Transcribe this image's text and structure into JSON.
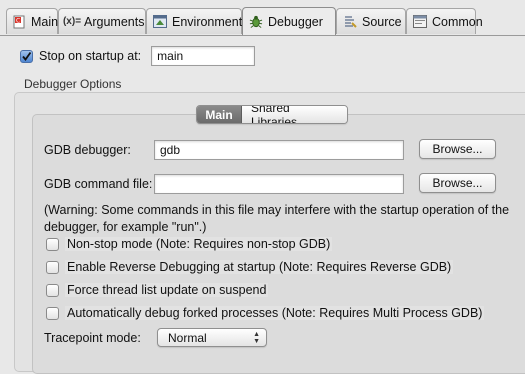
{
  "tabs": [
    {
      "label": "Main",
      "icon": "main-tab-icon"
    },
    {
      "label": "Arguments",
      "icon": "arguments-icon"
    },
    {
      "label": "Environment",
      "icon": "environment-icon"
    },
    {
      "label": "Debugger",
      "icon": "debugger-bug-icon",
      "active": true
    },
    {
      "label": "Source",
      "icon": "source-icon"
    },
    {
      "label": "Common",
      "icon": "common-icon"
    }
  ],
  "stop_on_startup": {
    "label": "Stop on startup at:",
    "checked": true,
    "value": "main"
  },
  "debugger_options": {
    "group_label": "Debugger Options",
    "segments": [
      "Main",
      "Shared Libraries"
    ],
    "selected_segment": "Main",
    "gdb_debugger_label": "GDB debugger:",
    "gdb_debugger_value": "gdb",
    "gdb_command_file_label": "GDB command file:",
    "gdb_command_file_value": "",
    "browse_label": "Browse...",
    "warning": "(Warning: Some commands in this file may interfere with the startup operation of the debugger, for example \"run\".)",
    "options": [
      {
        "label": "Non-stop mode (Note: Requires non-stop GDB)",
        "checked": false
      },
      {
        "label": "Enable Reverse Debugging at startup (Note: Requires Reverse GDB)",
        "checked": false
      },
      {
        "label": "Force thread list update on suspend",
        "checked": false
      },
      {
        "label": "Automatically debug forked processes (Note: Requires Multi Process GDB)",
        "checked": false
      }
    ],
    "tracepoint_mode_label": "Tracepoint mode:",
    "tracepoint_mode_value": "Normal"
  },
  "colors": {
    "window_bg": "#e8e8e8",
    "checkbox_checked": "#4f86d1",
    "segment_selected": "#6b6b6b"
  }
}
